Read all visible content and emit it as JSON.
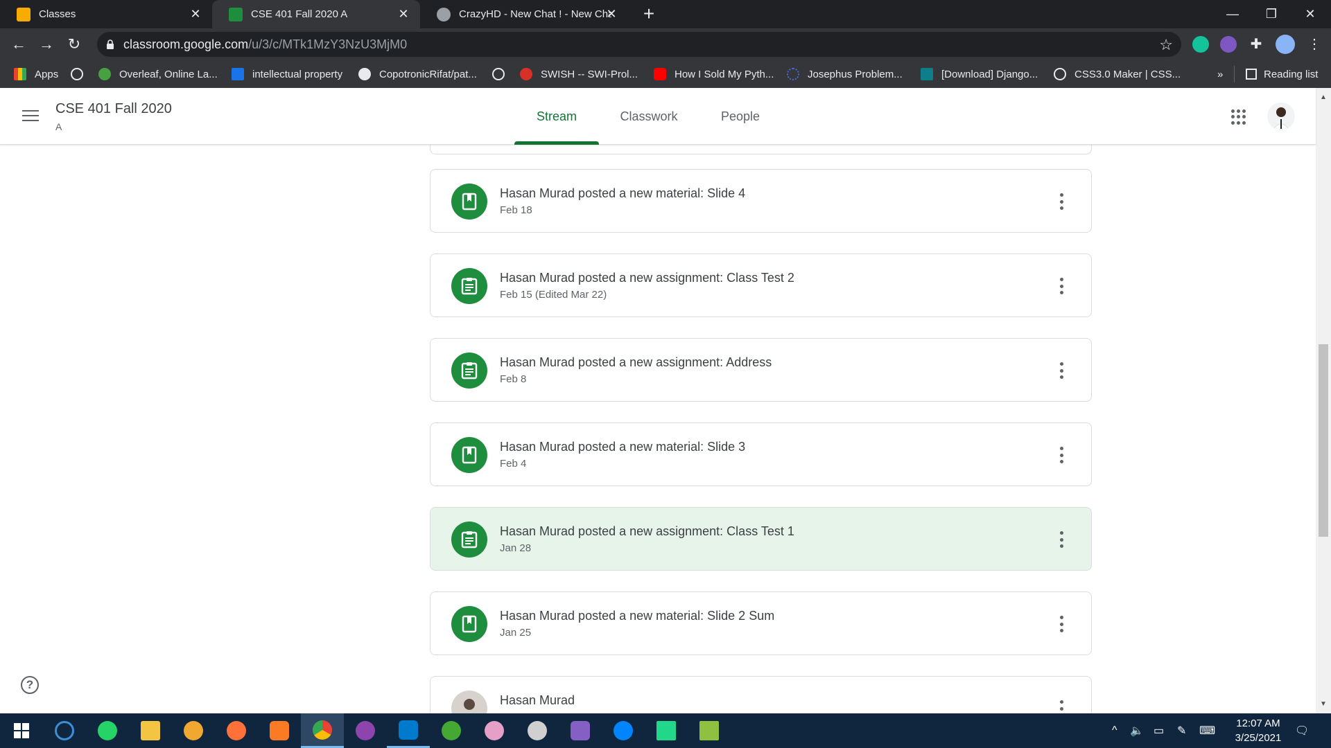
{
  "browser": {
    "tabs": [
      {
        "title": "Classes",
        "favicon_color": "#f9ab00"
      },
      {
        "title": "CSE 401 Fall 2020 A",
        "favicon_color": "#1e8e3e"
      },
      {
        "title": "CrazyHD - New Chat ! - New Cha",
        "favicon_color": "#9aa0a6"
      }
    ],
    "new_tab": "+",
    "window_controls": {
      "minimize": "—",
      "restore": "❐",
      "close": "✕"
    },
    "url_host": "classroom.google.com",
    "url_path": "/u/3/c/MTk1MzY3NzU3MjM0",
    "bookmarks": [
      {
        "label": "Apps",
        "icon": "apps-grid-icon",
        "color": "#ea4335"
      },
      {
        "label": "",
        "icon": "globe-icon",
        "color": "#e8eaed"
      },
      {
        "label": "Overleaf, Online La...",
        "icon": "overleaf-icon",
        "color": "#47a141"
      },
      {
        "label": "intellectual property",
        "icon": "scholar-icon",
        "color": "#1a73e8"
      },
      {
        "label": "CopotronicRifat/pat...",
        "icon": "github-icon",
        "color": "#e8eaed"
      },
      {
        "label": "",
        "icon": "globe-icon",
        "color": "#e8eaed"
      },
      {
        "label": "SWISH -- SWI-Prol...",
        "icon": "swish-icon",
        "color": "#d93025"
      },
      {
        "label": "How I Sold My Pyth...",
        "icon": "youtube-icon",
        "color": "#ff0000"
      },
      {
        "label": "Josephus Problem...",
        "icon": "spinner-icon",
        "color": "#4a6bdc"
      },
      {
        "label": "[Download] Django...",
        "icon": "django-icon",
        "color": "#0e7f8a"
      },
      {
        "label": "CSS3.0 Maker | CSS...",
        "icon": "globe-icon",
        "color": "#e8eaed"
      }
    ],
    "more_bookmarks": "»",
    "reading_list": "Reading list"
  },
  "classroom": {
    "class_name": "CSE 401 Fall 2020",
    "section": "A",
    "nav_tabs": [
      "Stream",
      "Classwork",
      "People"
    ],
    "active_tab": "Stream",
    "accent_color": "#137333"
  },
  "stream": {
    "items": [
      {
        "type": "material",
        "title": "Hasan Murad posted a new material: Slide 4",
        "date": "Feb 18"
      },
      {
        "type": "assignment",
        "title": "Hasan Murad posted a new assignment: Class Test 2",
        "date": "Feb 15 (Edited Mar 22)"
      },
      {
        "type": "assignment",
        "title": "Hasan Murad posted a new assignment: Address",
        "date": "Feb 8"
      },
      {
        "type": "material",
        "title": "Hasan Murad posted a new material: Slide 3",
        "date": "Feb 4"
      },
      {
        "type": "assignment",
        "title": "Hasan Murad posted a new assignment: Class Test 1",
        "date": "Jan 28",
        "highlighted": true
      },
      {
        "type": "material",
        "title": "Hasan Murad posted a new material: Slide 2 Sum",
        "date": "Jan 25"
      },
      {
        "type": "post",
        "title": "Hasan Murad",
        "date": ""
      }
    ]
  },
  "help": "?",
  "taskbar": {
    "apps": [
      {
        "name": "start-button",
        "color": "#ffffff"
      },
      {
        "name": "cortana",
        "color": "#3a8fd6"
      },
      {
        "name": "whatsapp",
        "color": "#25d366"
      },
      {
        "name": "file-explorer",
        "color": "#f4c542"
      },
      {
        "name": "tor-browser",
        "color": "#f0a830"
      },
      {
        "name": "firefox",
        "color": "#ff7139"
      },
      {
        "name": "xampp",
        "color": "#fb7a24"
      },
      {
        "name": "chrome",
        "color": "#4285f4"
      },
      {
        "name": "github-desktop",
        "color": "#8e44ad"
      },
      {
        "name": "vscode",
        "color": "#007acc"
      },
      {
        "name": "anaconda",
        "color": "#44a833"
      },
      {
        "name": "paint-app",
        "color": "#e6a0c8"
      },
      {
        "name": "inkscape",
        "color": "#d0d0d0"
      },
      {
        "name": "visual-studio",
        "color": "#865fc5"
      },
      {
        "name": "messenger",
        "color": "#0084ff"
      },
      {
        "name": "pycharm",
        "color": "#21d789"
      },
      {
        "name": "notepad-plus",
        "color": "#90c040"
      }
    ],
    "time": "12:07 AM",
    "date": "3/25/2021"
  }
}
